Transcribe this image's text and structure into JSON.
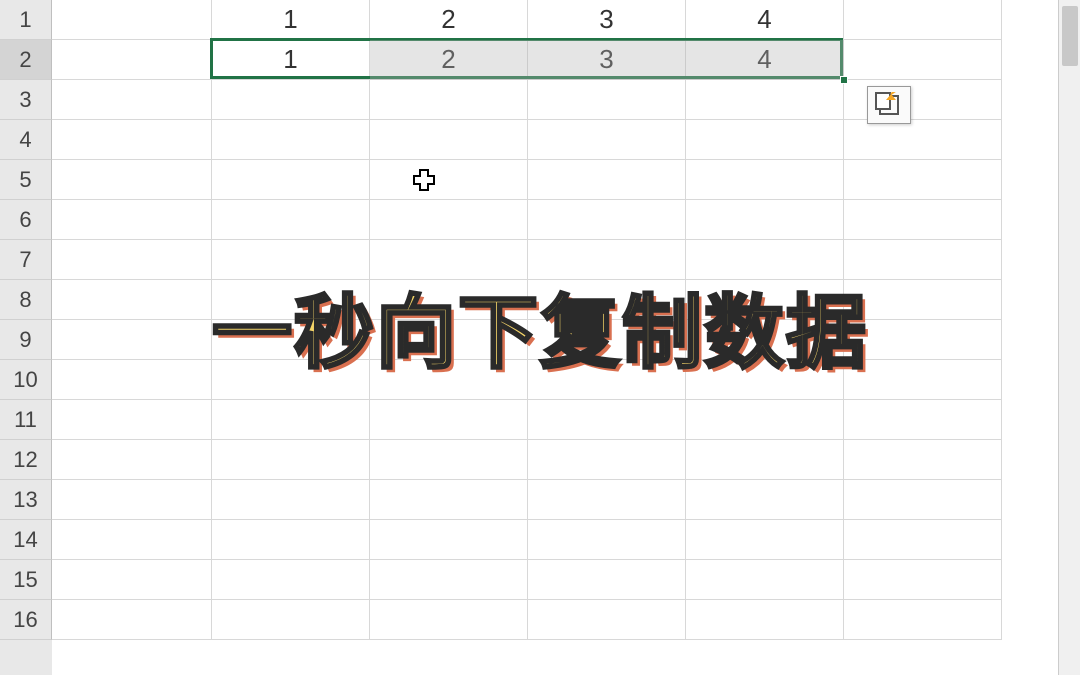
{
  "row_labels": [
    "1",
    "2",
    "3",
    "4",
    "5",
    "6",
    "7",
    "8",
    "9",
    "10",
    "11",
    "12",
    "13",
    "14",
    "15",
    "16"
  ],
  "active_row_index": 1,
  "grid": {
    "rows": [
      {
        "cells": [
          "",
          "1",
          "2",
          "3",
          "4",
          ""
        ]
      },
      {
        "cells": [
          "",
          "1",
          "2",
          "3",
          "4",
          ""
        ]
      }
    ],
    "total_rows": 16
  },
  "selection": {
    "row": 1,
    "col_start": 1,
    "col_end": 4
  },
  "overlay_text": "一秒向下复制数据"
}
